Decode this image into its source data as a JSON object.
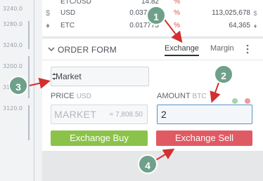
{
  "chart_axis": {
    "labels": [
      "3240.0",
      "3280.0",
      "3240.0",
      "3200.0",
      "3160.0",
      "3120.0"
    ]
  },
  "ticker": {
    "rows": [
      {
        "symbol": "",
        "name": "ETC/USD",
        "last": "14.82",
        "change": "%",
        "volume": "",
        "vol_currency": ""
      },
      {
        "symbol": "$",
        "name": "USD",
        "last": "0.037590",
        "change": "%",
        "volume": "113,025,678",
        "vol_currency": "$"
      },
      {
        "symbol": "♦",
        "name": "ETC",
        "last": "0.017773",
        "change": "%",
        "volume": "64,365",
        "vol_currency": "♦"
      }
    ]
  },
  "order_form": {
    "title": "ORDER FORM",
    "tabs": {
      "exchange": "Exchange",
      "margin": "Margin"
    },
    "order_type": "Market",
    "price_label": "PRICE",
    "price_currency": "USD",
    "price_placeholder": "MARKET",
    "price_estimate": "≈ 7,808.50",
    "amount_label": "AMOUNT",
    "amount_currency": "BTC",
    "amount_value": "2",
    "buy_label": "Exchange Buy",
    "sell_label": "Exchange Sell"
  },
  "callouts": {
    "one": "1",
    "two": "2",
    "three": "3",
    "four": "4"
  },
  "colors": {
    "buy": "#8bc34a",
    "sell": "#e05a63",
    "badge": "#6ea08a",
    "arrow": "#d32f2f",
    "dot_green": "#a5d6a7",
    "dot_red": "#ef9a9a"
  }
}
